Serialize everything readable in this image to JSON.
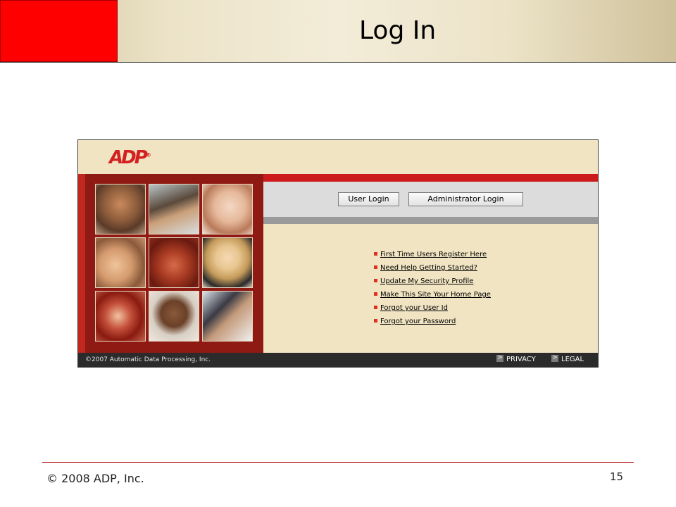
{
  "slide": {
    "title": "Log In",
    "copyright": "© 2008 ADP, Inc.",
    "page_number": "15",
    "accent_color": "#ff0000"
  },
  "screenshot": {
    "logo_text": "ADP",
    "buttons": {
      "user_login": "User Login",
      "admin_login": "Administrator Login"
    },
    "links": [
      "First Time Users Register Here",
      "Need Help Getting Started?",
      "Update My Security Profile",
      "Make This Site Your Home Page",
      "Forgot your User Id",
      "Forgot your Password"
    ],
    "footer": {
      "copyright": "©2007 Automatic Data Processing, Inc.",
      "privacy": "PRIVACY",
      "legal": "LEGAL",
      "link_marker": ">"
    },
    "colors": {
      "brand_red": "#cc1a1a",
      "panel_beige": "#f0e4c3",
      "photo_panel": "#8f1a14"
    }
  }
}
